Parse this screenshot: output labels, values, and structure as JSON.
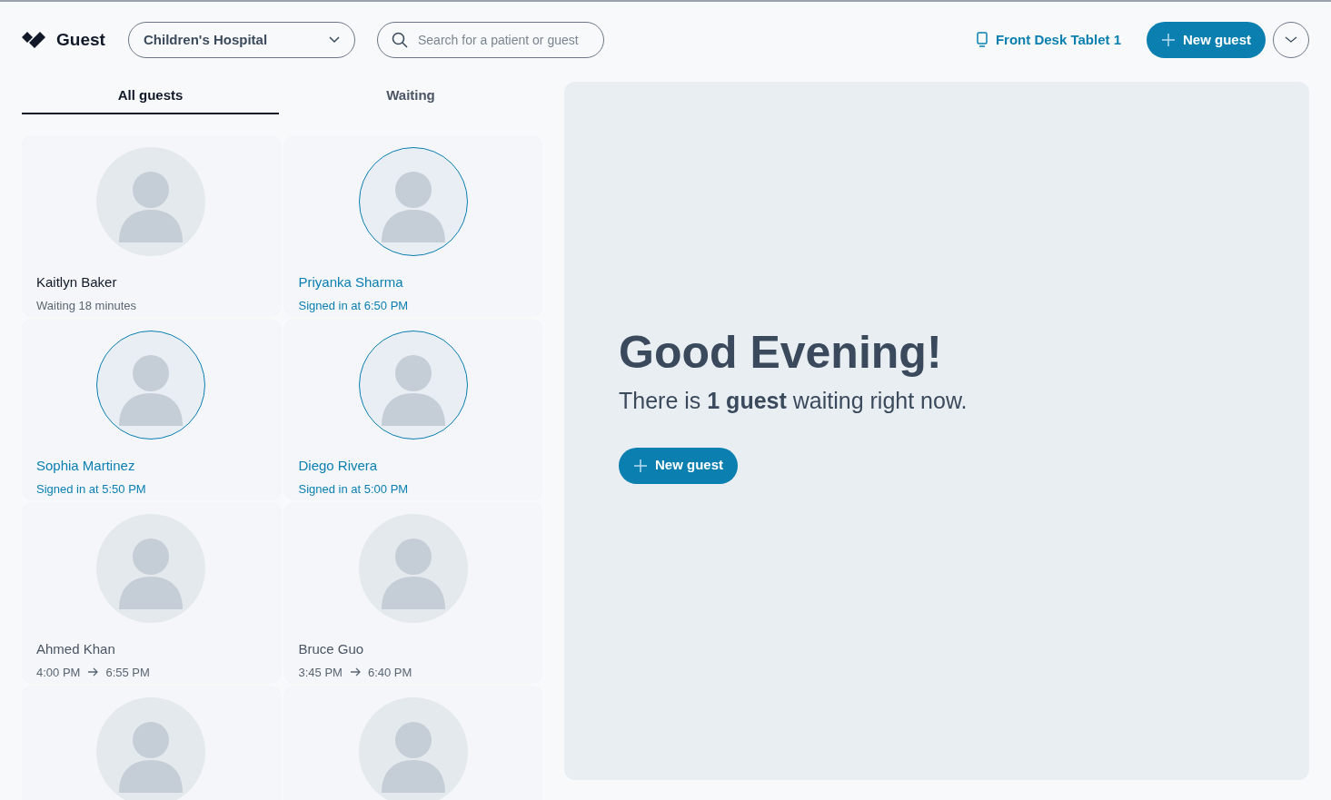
{
  "header": {
    "app_name": "Guest",
    "location_select": {
      "value": "Children's Hospital"
    },
    "search": {
      "placeholder": "Search for a patient or guest"
    },
    "device": "Front Desk Tablet 1",
    "new_guest_button": "New guest"
  },
  "tabs": [
    {
      "label": "All guests",
      "selected": true
    },
    {
      "label": "Waiting",
      "selected": false
    }
  ],
  "guests": [
    {
      "kind": "waiting",
      "name": "Kaitlyn Baker",
      "status": "Waiting 18 minutes"
    },
    {
      "kind": "signed_in",
      "name": "Priyanka Sharma",
      "status": "Signed in at 6:50 PM"
    },
    {
      "kind": "signed_in",
      "name": "Sophia Martinez",
      "status": "Signed in at 5:50 PM"
    },
    {
      "kind": "signed_in",
      "name": "Diego Rivera",
      "status": "Signed in at 5:00 PM"
    },
    {
      "kind": "departed",
      "name": "Ahmed Khan",
      "time_in": "4:00 PM",
      "time_out": "6:55 PM"
    },
    {
      "kind": "departed",
      "name": "Bruce Guo",
      "time_in": "3:45 PM",
      "time_out": "6:40 PM"
    },
    {
      "kind": "departed"
    },
    {
      "kind": "departed"
    }
  ],
  "welcome": {
    "heading": "Good Evening!",
    "message": "There is **1 guest** waiting right now.",
    "button": "New guest"
  }
}
